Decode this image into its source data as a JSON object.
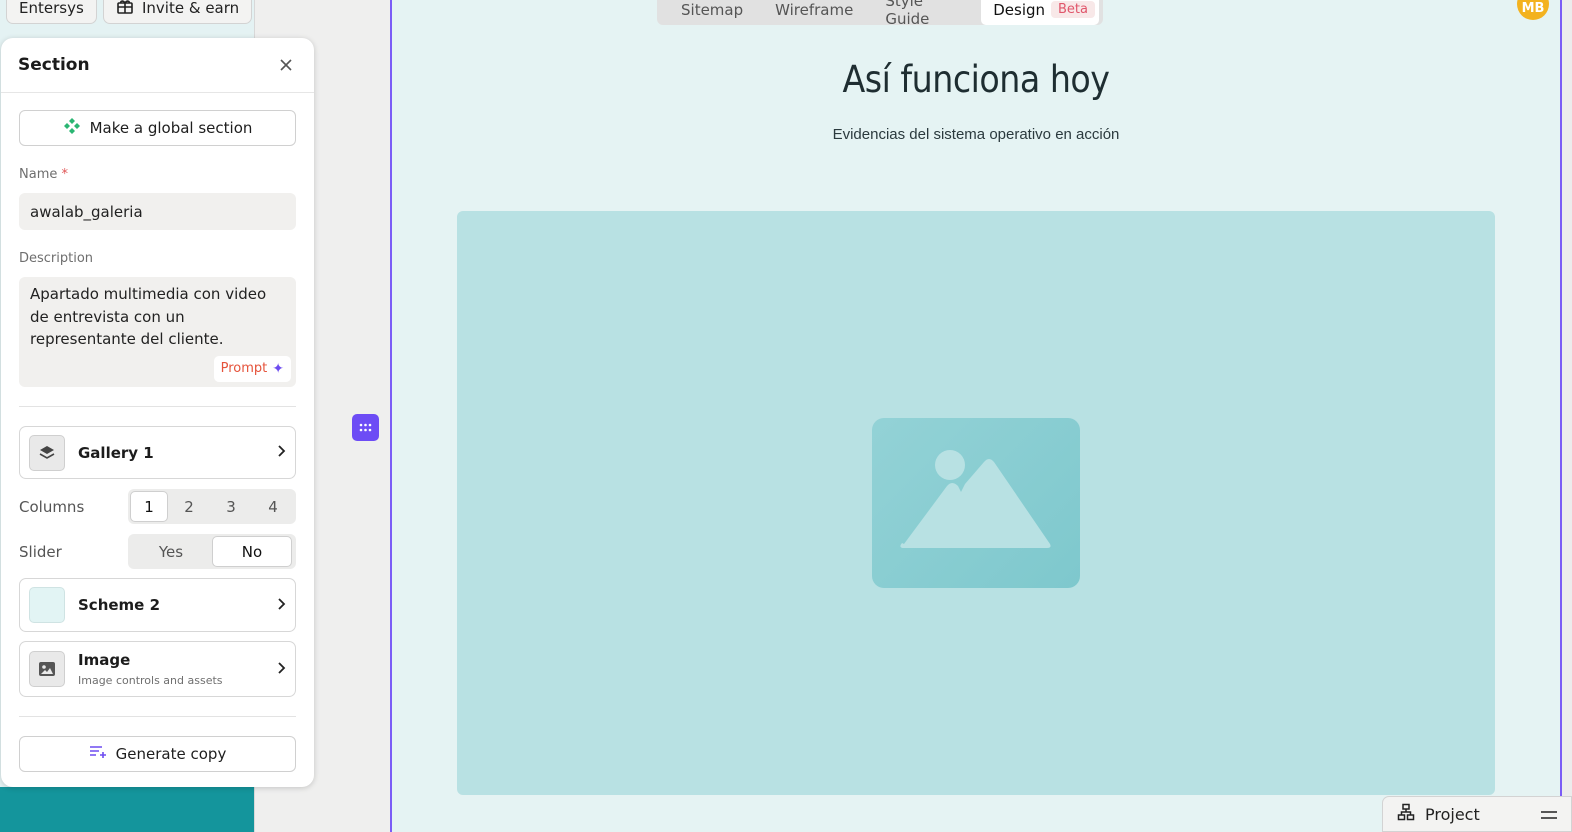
{
  "topbar": {
    "workspace_label": "Entersys",
    "invite_label": "Invite & earn",
    "tabs": [
      {
        "label": "Sitemap"
      },
      {
        "label": "Wireframe"
      },
      {
        "label": "Style Guide"
      },
      {
        "label": "Design",
        "badge": "Beta",
        "active": true
      }
    ],
    "avatar_initials": "MB"
  },
  "panel": {
    "title": "Section",
    "global_button": "Make a global section",
    "name_label": "Name",
    "name_required_mark": "*",
    "name_value": "awalab_galeria",
    "description_label": "Description",
    "description_value": "Apartado multimedia con video de entrevista con un representante del cliente.",
    "prompt_button": "Prompt",
    "gallery_row": "Gallery 1",
    "columns_label": "Columns",
    "columns_options": [
      "1",
      "2",
      "3",
      "4"
    ],
    "columns_selected": "1",
    "slider_label": "Slider",
    "slider_options": [
      "Yes",
      "No"
    ],
    "slider_selected": "No",
    "scheme_row": "Scheme 2",
    "image_row_title": "Image",
    "image_row_sub": "Image controls and assets",
    "generate_button": "Generate copy"
  },
  "canvas": {
    "heading": "Así funciona hoy",
    "subheading": "Evidencias del sistema operativo en acción"
  },
  "bottom": {
    "project_label": "Project"
  },
  "colors": {
    "accent": "#7b5cf6",
    "canvas_bg": "#e5f3f3",
    "gallery_bg": "#b8e1e3",
    "scheme_swatch": "#e2f4f4"
  }
}
